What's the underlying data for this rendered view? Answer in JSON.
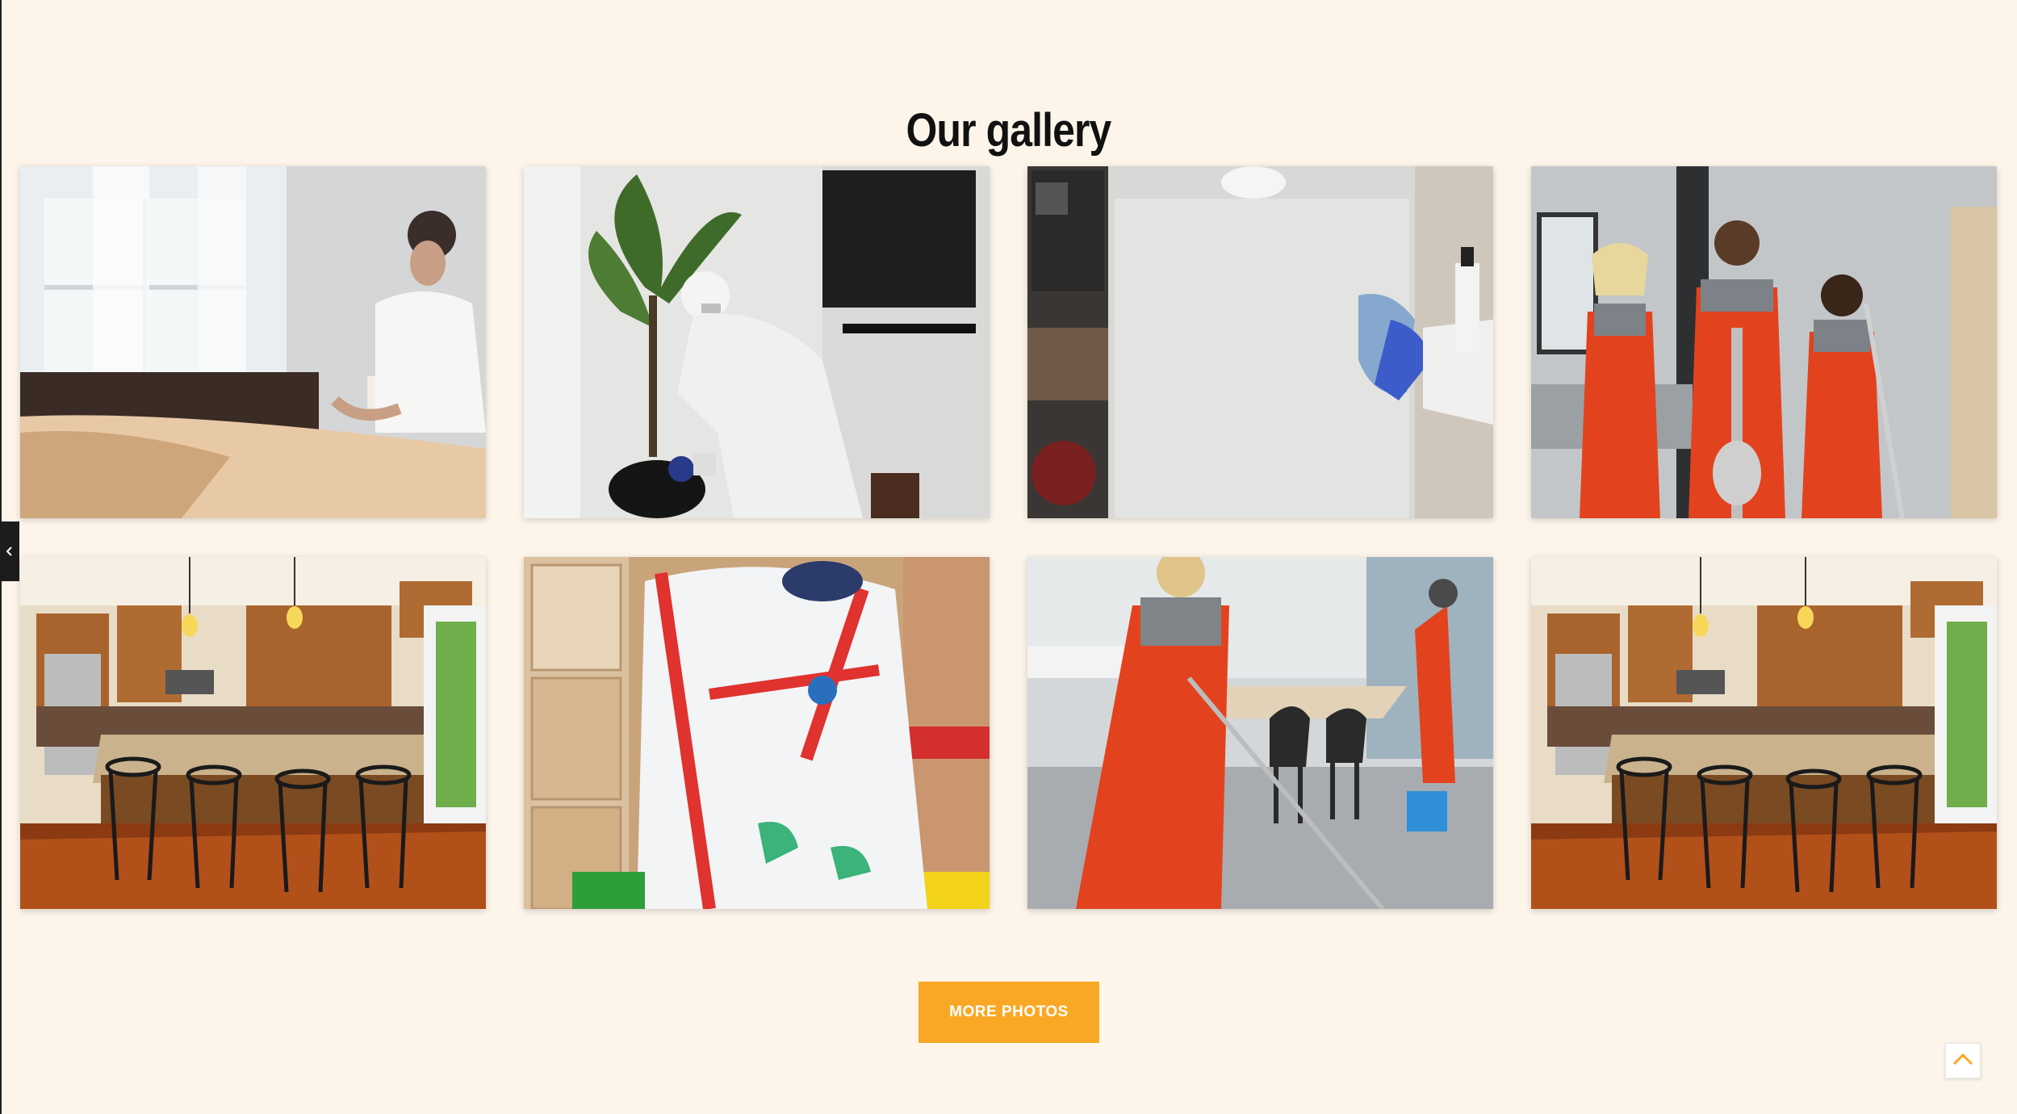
{
  "section": {
    "title": "Our gallery"
  },
  "gallery": {
    "photos": [
      {
        "subject": "maid making bed"
      },
      {
        "subject": "worker in protective suit disinfecting plant"
      },
      {
        "subject": "gloved hand wiping fridge"
      },
      {
        "subject": "cleaning team in orange overalls"
      },
      {
        "subject": "kitchen with wooden cabinets"
      },
      {
        "subject": "worker in hazmat suit with harness"
      },
      {
        "subject": "cleaners mopping dining room"
      },
      {
        "subject": "kitchen with wooden cabinets"
      }
    ]
  },
  "actions": {
    "more_photos_label": "MORE PHOTOS"
  },
  "icons": {
    "side_toggle": "chevron-left-icon",
    "scroll_top": "chevron-up-icon"
  },
  "colors": {
    "background": "#fdf5ea",
    "accent": "#f9a825",
    "text": "#111111"
  }
}
